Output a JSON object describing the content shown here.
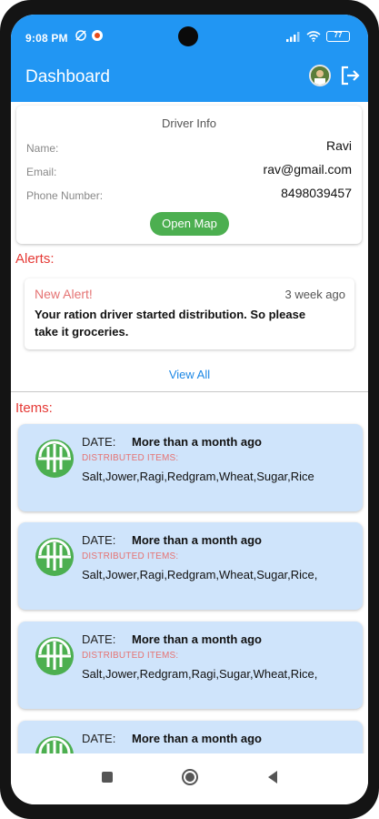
{
  "status_bar": {
    "time": "9:08 PM",
    "battery": "77"
  },
  "app_bar": {
    "title": "Dashboard"
  },
  "driver_info": {
    "title": "Driver Info",
    "name_label": "Name:",
    "name_value": "Ravi",
    "email_label": "Email:",
    "email_value": "rav@gmail.com",
    "phone_label": "Phone Number:",
    "phone_value": "8498039457",
    "open_map_label": "Open Map"
  },
  "alerts": {
    "section_title": "Alerts:",
    "items": [
      {
        "title": "New Alert!",
        "time": "3 week ago",
        "message": "Your ration driver started distribution. So please take it groceries."
      }
    ],
    "view_all_label": "View All"
  },
  "items": {
    "section_title": "Items:",
    "cards": [
      {
        "date_label": "DATE:",
        "date_value": "More than a month ago",
        "distributed_label": "DISTRIBUTED ITEMS:",
        "list": "Salt,Jower,Ragi,Redgram,Wheat,Sugar,Rice"
      },
      {
        "date_label": "DATE:",
        "date_value": "More than a month ago",
        "distributed_label": "DISTRIBUTED ITEMS:",
        "list": "Salt,Jower,Ragi,Redgram,Wheat,Sugar,Rice,"
      },
      {
        "date_label": "DATE:",
        "date_value": "More than a month ago",
        "distributed_label": "DISTRIBUTED ITEMS:",
        "list": "Salt,Jower,Redgram,Ragi,Sugar,Wheat,Rice,"
      },
      {
        "date_label": "DATE:",
        "date_value": "More than a month ago",
        "distributed_label": "",
        "list": ""
      }
    ]
  },
  "icons": {
    "logout": "logout-icon",
    "item": "rice-bowl-icon",
    "nav_recents": "square-icon",
    "nav_home": "circle-icon",
    "nav_back": "triangle-back-icon"
  },
  "colors": {
    "primary": "#2196f3",
    "accent_green": "#4caf50",
    "alert_red": "#e53935",
    "item_card_bg": "#cfe4fb"
  }
}
